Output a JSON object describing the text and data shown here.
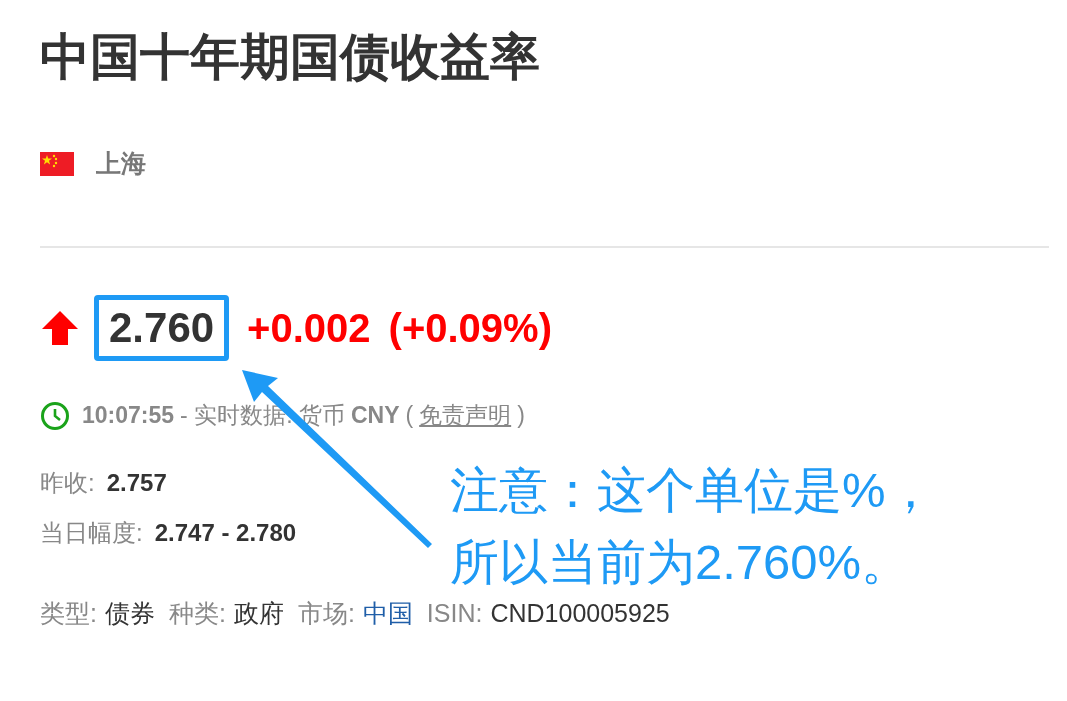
{
  "title": "中国十年期国债收益率",
  "location": {
    "name": "上海"
  },
  "price": {
    "rising": true,
    "value": "2.760",
    "highlighted": true,
    "change": "+0.002",
    "change_percent": "(+0.09%)"
  },
  "status": {
    "time": "10:07:55",
    "description": "- 实时数据.",
    "currency": "货币 **CNY**",
    "paren_open": "(",
    "disclaimer": "免责声明",
    "paren_close": ")"
  },
  "stats": [
    {
      "label": "昨收:",
      "value": "2.757"
    },
    {
      "label": "当日幅度:",
      "value": "2.747 - 2.780"
    }
  ],
  "info": [
    {
      "label": "类型:",
      "value": "债券",
      "kind": "text"
    },
    {
      "label": "种类:",
      "value": "政府",
      "kind": "text"
    },
    {
      "label": "市场:",
      "value": "中国",
      "kind": "link"
    },
    {
      "label": "ISIN:",
      "value": "CND100005925",
      "kind": "text"
    }
  ],
  "annotation": {
    "lines": [
      "注意：这个单位是%，",
      "所以当前为2.760%。"
    ]
  }
}
